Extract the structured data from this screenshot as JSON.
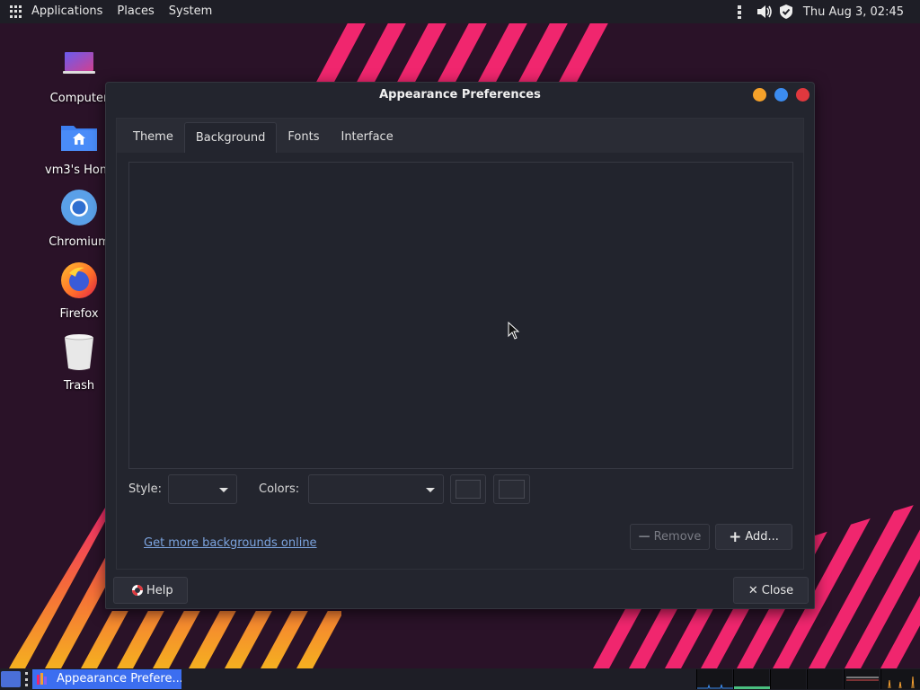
{
  "top_panel": {
    "menus": [
      "Applications",
      "Places",
      "System"
    ],
    "clock": "Thu Aug  3, 02:45"
  },
  "desktop_icons": [
    {
      "label": "Computer",
      "icon": "computer-icon"
    },
    {
      "label": "vm3's Home",
      "icon": "home-folder-icon"
    },
    {
      "label": "Chromium",
      "icon": "chromium-icon"
    },
    {
      "label": "Firefox",
      "icon": "firefox-icon"
    },
    {
      "label": "Trash",
      "icon": "trash-icon"
    }
  ],
  "window": {
    "title": "Appearance Preferences",
    "tabs": [
      "Theme",
      "Background",
      "Fonts",
      "Interface"
    ],
    "active_tab": "Background",
    "style_label": "Style:",
    "colors_label": "Colors:",
    "online_link": "Get more backgrounds online",
    "remove_label": "Remove",
    "add_label": "Add...",
    "help_label": "Help",
    "close_label": "Close"
  },
  "taskbar": {
    "task_label": "Appearance Prefere..."
  },
  "colors": {
    "accent": "#3c6ef0",
    "wallpaper_stripes_pink": "#f0266e",
    "wallpaper_stripes_orange": "#f5a030",
    "window_bg": "#23252e",
    "link": "#7ca4df"
  }
}
